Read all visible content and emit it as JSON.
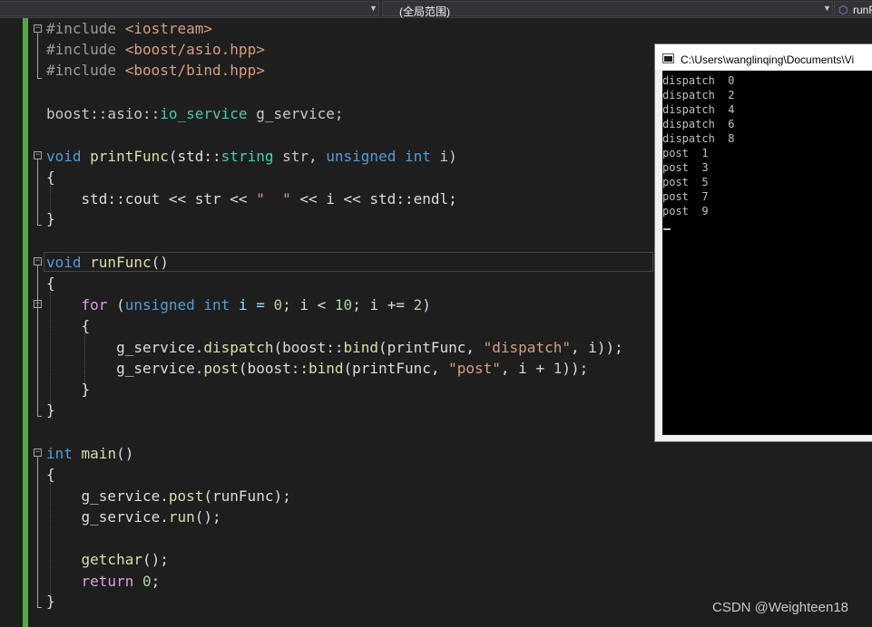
{
  "nav": {
    "scope_dropdown": "(全局范围)",
    "member_dropdown": "runFunc()"
  },
  "code": {
    "include1": "#include ",
    "inc1": "<iostream>",
    "include2": "#include ",
    "inc2": "<boost/asio.hpp>",
    "include3": "#include ",
    "inc3": "<boost/bind.hpp>",
    "l5_ns": "boost::asio::",
    "l5_type": "io_service",
    "l5_var": " g_service;",
    "l7_void": "void",
    "l7_fn": "printFunc",
    "l7_p1": "(std::",
    "l7_string": "string",
    "l7_p2": " str, ",
    "l7_unsigned": "unsigned",
    "l7_sp": " ",
    "l7_int": "int",
    "l7_p3": " i)",
    "l8": "{",
    "l9_a": "    std::cout << str << ",
    "l9_str": "\"  \"",
    "l9_b": " << i << std::endl;",
    "l10": "}",
    "l12_void": "void",
    "l12_fn": " runFunc",
    "l12_p": "()",
    "l13": "{",
    "l14_for": "    for",
    "l14_a": " (",
    "l14_unsigned": "unsigned",
    "l14_sp": " ",
    "l14_int": "int",
    "l14_b": " i = ",
    "l14_n0": "0",
    "l14_c": "; i < ",
    "l14_n10": "10",
    "l14_d": "; i += ",
    "l14_n2": "2",
    "l14_e": ")",
    "l15": "    {",
    "l16_a": "        g_service.",
    "l16_fn": "dispatch",
    "l16_b": "(boost::",
    "l16_bind": "bind",
    "l16_c": "(printFunc, ",
    "l16_str": "\"dispatch\"",
    "l16_d": ", i));",
    "l17_a": "        g_service.",
    "l17_fn": "post",
    "l17_b": "(boost::",
    "l17_bind": "bind",
    "l17_c": "(printFunc, ",
    "l17_str": "\"post\"",
    "l17_d": ", i + ",
    "l17_n1": "1",
    "l17_e": "));",
    "l18": "    }",
    "l19": "}",
    "l21_int": "int",
    "l21_fn": " main",
    "l21_p": "()",
    "l22": "{",
    "l23_a": "    g_service.",
    "l23_fn": "post",
    "l23_b": "(runFunc);",
    "l24_a": "    g_service.",
    "l24_fn": "run",
    "l24_b": "();",
    "l26_fn": "    getchar",
    "l26_b": "();",
    "l27_ret": "    return",
    "l27_sp": " ",
    "l27_n": "0",
    "l27_b": ";",
    "l28": "}"
  },
  "console": {
    "title": "C:\\Users\\wanglinqing\\Documents\\Vi",
    "output": [
      "dispatch  0",
      "dispatch  2",
      "dispatch  4",
      "dispatch  6",
      "dispatch  8",
      "post  1",
      "post  3",
      "post  5",
      "post  7",
      "post  9"
    ]
  },
  "watermark": "CSDN @Weighteen18"
}
